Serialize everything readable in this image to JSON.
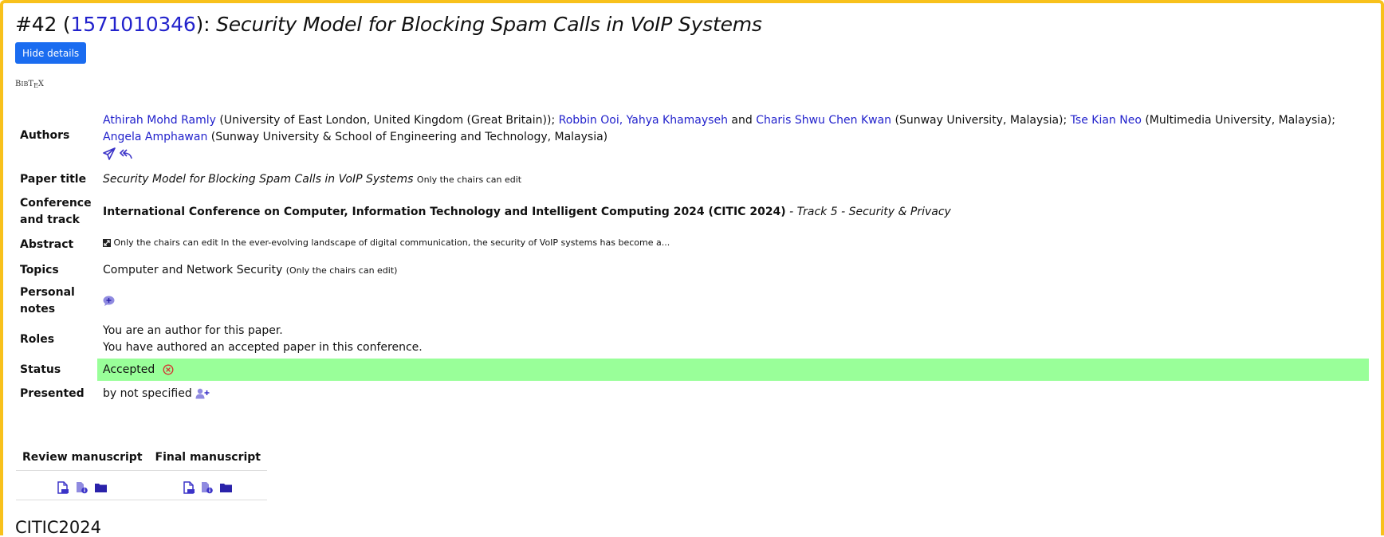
{
  "header": {
    "number": "#42",
    "paper_id": "1571010346",
    "title": "Security Model for Blocking Spam Calls in VoIP Systems",
    "hide_button": "Hide details",
    "bibtex": "BIBTEX"
  },
  "details": {
    "authors": {
      "label": "Authors",
      "parts": [
        {
          "text": "Athirah Mohd Ramly",
          "link": true
        },
        {
          "text": " (University of East London, United Kingdom (Great Britain)); ",
          "link": false
        },
        {
          "text": "Robbin Ooi, Yahya Khamayseh",
          "link": true
        },
        {
          "text": " and ",
          "link": false
        },
        {
          "text": "Charis Shwu Chen Kwan",
          "link": true
        },
        {
          "text": " (Sunway University, Malaysia); ",
          "link": false
        },
        {
          "text": "Tse Kian Neo",
          "link": true
        },
        {
          "text": " (Multimedia University, Malaysia); ",
          "link": false
        },
        {
          "text": "Angela Amphawan",
          "link": true
        },
        {
          "text": " (Sunway University & School of Engineering and Technology, Malaysia)",
          "link": false
        }
      ],
      "icons": [
        "send-icon",
        "reply-all-icon"
      ]
    },
    "paper_title": {
      "label": "Paper title",
      "value": "Security Model for Blocking Spam Calls in VoIP Systems",
      "note": "Only the chairs can edit"
    },
    "conference": {
      "label_line1": "Conference",
      "label_line2": "and track",
      "name": "International Conference on Computer, Information Technology and Intelligent Computing 2024 (CITIC 2024)",
      "track": " - Track 5 - Security & Privacy"
    },
    "abstract": {
      "label": "Abstract",
      "text": "Only the chairs can edit In the ever-evolving landscape of digital communication, the security of VoIP systems has become a..."
    },
    "topics": {
      "label": "Topics",
      "value": "Computer and Network Security",
      "note": "(Only the chairs can edit)"
    },
    "personal_notes": {
      "label_line1": "Personal",
      "label_line2": "notes"
    },
    "roles": {
      "label": "Roles",
      "line1": "You are an author for this paper.",
      "line2": "You have authored an accepted paper in this conference."
    },
    "status": {
      "label": "Status",
      "value": "Accepted",
      "color": "#99ff99"
    },
    "presented": {
      "label": "Presented",
      "value": "by not specified"
    }
  },
  "manuscripts": {
    "review_header": "Review manuscript",
    "final_header": "Final manuscript",
    "icons": [
      "pdf-file-icon",
      "file-info-icon",
      "folder-icon"
    ]
  },
  "footer": {
    "title": "CITIC2024"
  },
  "colors": {
    "frame": "#f8c11c",
    "button": "#1a6cf0",
    "link": "#2222cc",
    "icon": "#3b33c8"
  }
}
